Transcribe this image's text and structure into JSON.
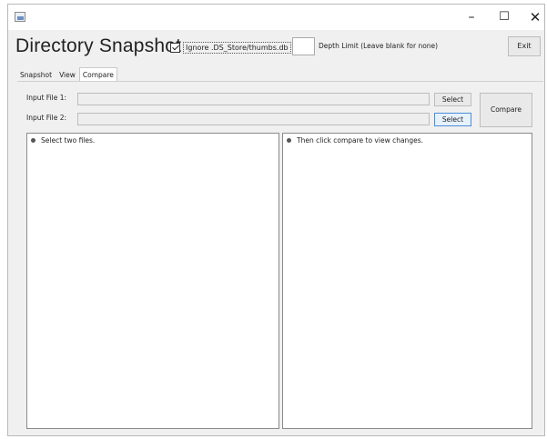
{
  "window": {
    "controls": {
      "minimize": "–",
      "maximize": "☐",
      "close": "✕"
    }
  },
  "header": {
    "title": "Directory Snapshot",
    "ignore_checkbox_label": "Ignore .DS_Store/thumbs.db",
    "ignore_checked": true,
    "depth_value": "",
    "depth_label": "Depth Limit (Leave blank for none)",
    "exit_label": "Exit"
  },
  "tabs": [
    {
      "label": "Snapshot",
      "active": false
    },
    {
      "label": "View",
      "active": false
    },
    {
      "label": "Compare",
      "active": true
    }
  ],
  "compare": {
    "input1_label": "Input File 1:",
    "input1_value": "",
    "input2_label": "Input File 2:",
    "input2_value": "",
    "select_label": "Select",
    "compare_label": "Compare",
    "left_list": [
      "Select two files."
    ],
    "right_list": [
      "Then click compare to view changes."
    ]
  }
}
